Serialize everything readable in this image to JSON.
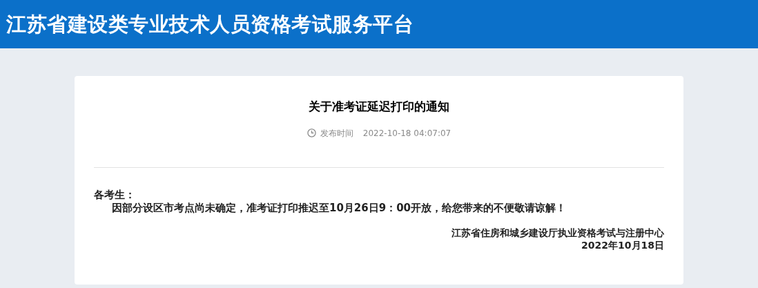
{
  "header": {
    "title": "江苏省建设类专业技术人员资格考试服务平台"
  },
  "notice": {
    "title": "关于准考证延迟打印的通知",
    "publish_label": "发布时间",
    "publish_time": "2022-10-18 04:07:07",
    "salutation": "各考生：",
    "body": "因部分设区市考点尚未确定，准考证打印推迟至10月26日9：00开放，给您带来的不便敬请谅解！",
    "signature": "江苏省住房和城乡建设厅执业资格考试与注册中心",
    "date": "2022年10月18日"
  }
}
